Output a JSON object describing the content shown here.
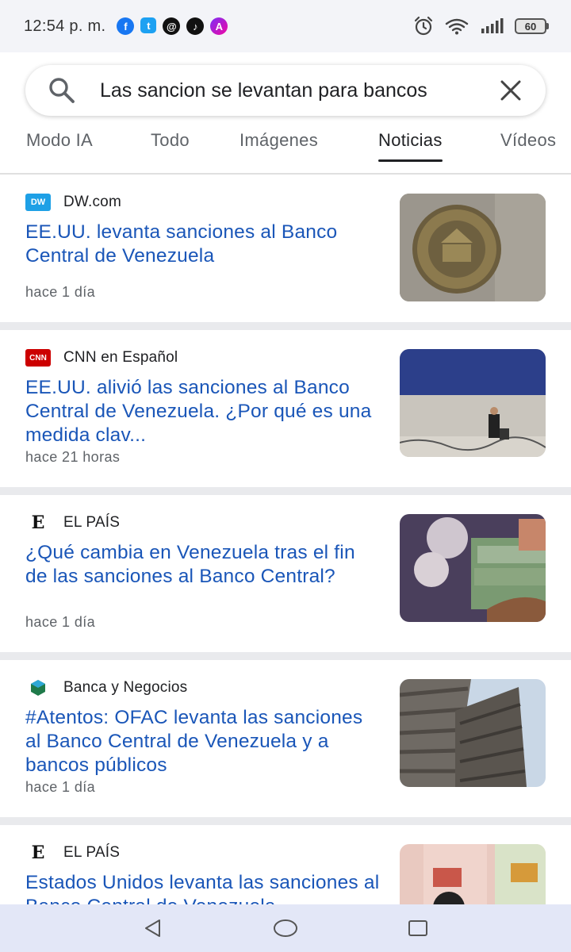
{
  "status_bar": {
    "time": "12:54 p. m.",
    "battery": "60",
    "notification_icons": [
      "facebook-icon",
      "twitter-icon",
      "threads-icon",
      "tiktok-icon",
      "ai-app-icon"
    ]
  },
  "search": {
    "query": "Las sancion se levantan para bancos"
  },
  "tabs": [
    {
      "label": "Modo IA"
    },
    {
      "label": "Todo"
    },
    {
      "label": "Imágenes"
    },
    {
      "label": "Noticias"
    },
    {
      "label": "Vídeos"
    }
  ],
  "active_tab": "Noticias",
  "articles": [
    {
      "source": "DW.com",
      "favicon_text": "DW",
      "headline": "EE.UU. levanta sanciones al Banco Central de Venezuela",
      "age": "hace 1 día"
    },
    {
      "source": "CNN en Español",
      "favicon_text": "CNN",
      "headline": "EE.UU. alivió las sanciones al Banco Central de Venezuela. ¿Por qué es una medida clav...",
      "age": "hace 21 horas"
    },
    {
      "source": "EL PAÍS",
      "favicon_text": "E",
      "headline": "¿Qué cambia en Venezuela tras el fin de las sanciones al Banco Central?",
      "age": "hace 1 día"
    },
    {
      "source": "Banca y Negocios",
      "favicon_text": "",
      "headline": "#Atentos: OFAC levanta las sanciones al Banco Central de Venezuela y a bancos públicos",
      "age": "hace 1 día"
    },
    {
      "source": "EL PAÍS",
      "favicon_text": "E",
      "headline": "Estados Unidos levanta las sanciones al Banco Central de Venezuela",
      "age": ""
    }
  ],
  "colors": {
    "headline": "#1a56b8",
    "status_bg": "#f3f4f8",
    "nav_bg": "#e3e7f7",
    "separator": "#e9eaed"
  },
  "navbar": [
    "back-icon",
    "home-icon",
    "recents-icon"
  ]
}
